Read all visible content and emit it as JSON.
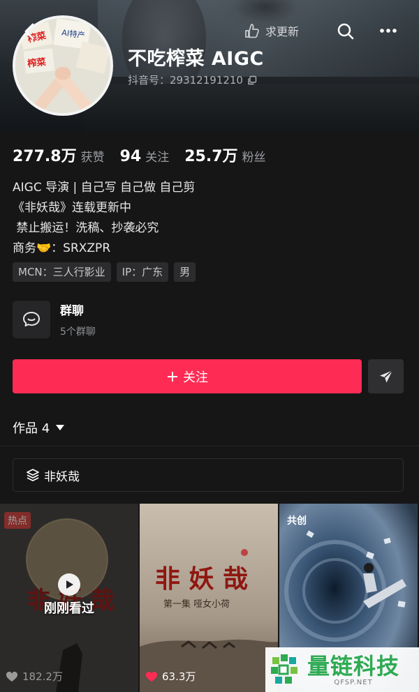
{
  "header": {
    "hint_label": "求更新",
    "profile_name": "不吃榨菜 AIGC",
    "douyin_id": "抖音号：29312191210",
    "icons": [
      "back-arrow-icon",
      "hand-point-icon",
      "search-icon",
      "more-icon",
      "copy-icon"
    ]
  },
  "stats": [
    {
      "value": "277.8万",
      "label": "获赞"
    },
    {
      "value": "94",
      "label": "关注"
    },
    {
      "value": "25.7万",
      "label": "粉丝"
    }
  ],
  "bio": [
    "AIGC 导演 | 自己写 自己做 自己剪",
    "《非妖哉》连载更新中",
    " 禁止搬运！洗稿、抄袭必究",
    "商务🤝：SRXZPR"
  ],
  "tags": [
    "MCN：三人行影业",
    "IP：广东",
    "男"
  ],
  "group": {
    "title": "群聊",
    "subtitle": "5个群聊"
  },
  "actions": {
    "follow_label": "关注",
    "follow_color": "#fe2c55"
  },
  "works": {
    "tab_label": "作品 4",
    "collection_label": "非妖哉"
  },
  "videos": [
    {
      "badge": "热点",
      "overlay": "刚刚看过",
      "likes": "182.2万"
    },
    {
      "badge": "",
      "overlay": "",
      "likes": "63.3万"
    },
    {
      "badge": "共创",
      "overlay": "",
      "likes": ""
    }
  ],
  "watermark": {
    "cn": "量链科技",
    "en": "QFSP.NET"
  }
}
